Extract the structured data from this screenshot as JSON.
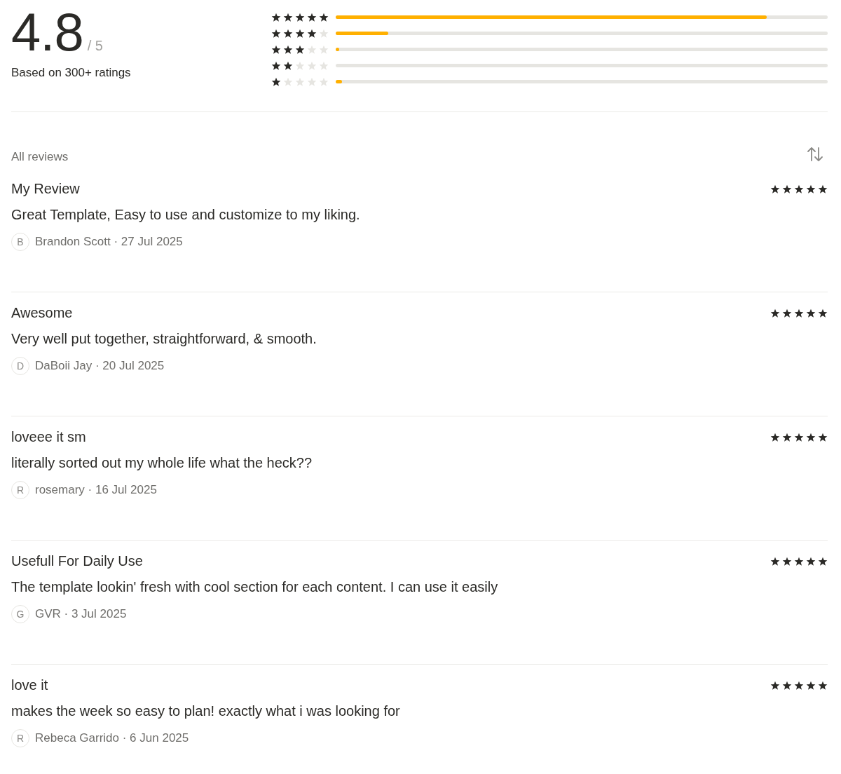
{
  "summary": {
    "score": "4.8",
    "out_of": "/ 5",
    "based_on": "Based on 300+ ratings"
  },
  "distribution": [
    {
      "stars": 5,
      "level": 0.876
    },
    {
      "stars": 4,
      "level": 0.107
    },
    {
      "stars": 3,
      "level": 0.006
    },
    {
      "stars": 2
    },
    {
      "stars": 1,
      "level": 0.013
    }
  ],
  "reviews_header": {
    "title": "All reviews"
  },
  "reviews": [
    {
      "title": "My Review",
      "stars": 5,
      "body": "Great Template, Easy to use and customize to my liking.",
      "initial": "B",
      "byline": "Brandon Scott · 27 Jul 2025"
    },
    {
      "title": "Awesome",
      "stars": 5,
      "body": "Very well put together, straightforward, & smooth.",
      "initial": "D",
      "byline": "DaBoii Jay · 20 Jul 2025"
    },
    {
      "title": "loveee it sm",
      "stars": 5,
      "body": "literally sorted out my whole life what the heck??",
      "initial": "R",
      "byline": "rosemary · 16 Jul 2025"
    },
    {
      "title": "Usefull For Daily Use",
      "stars": 5,
      "body": "The template lookin' fresh with cool section for each content. I can use it easily",
      "initial": "G",
      "byline": "GVR · 3 Jul 2025"
    },
    {
      "title": "love it",
      "stars": 5,
      "body": "makes the week so easy to plan! exactly what i was looking for",
      "initial": "R",
      "byline": "Rebeca Garrido · 6 Jun 2025"
    }
  ]
}
